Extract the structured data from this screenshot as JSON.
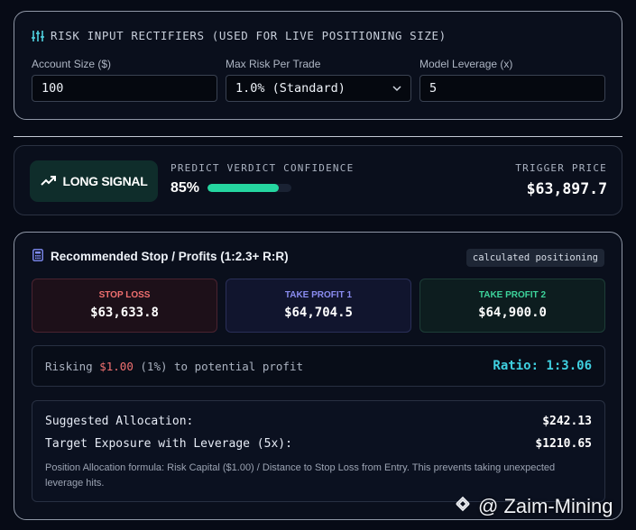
{
  "inputs": {
    "header": "RISK INPUT RECTIFIERS (USED FOR LIVE POSITIONING SIZE)",
    "header_icon": "sliders-icon",
    "account_size": {
      "label": "Account Size ($)",
      "value": "100"
    },
    "max_risk": {
      "label": "Max Risk Per Trade",
      "value": "1.0% (Standard)"
    },
    "leverage": {
      "label": "Model Leverage (x)",
      "value": "5"
    }
  },
  "signal": {
    "badge_label": "LONG SIGNAL",
    "badge_icon": "trending-up-icon",
    "confidence_label": "PREDICT VERDICT CONFIDENCE",
    "confidence_value": "85%",
    "confidence_fraction": 0.85,
    "trigger_label": "TRIGGER PRICE",
    "trigger_value": "$63,897.7"
  },
  "stops": {
    "title": "Recommended Stop / Profits (1:2.3+ R:R)",
    "title_icon": "calculator-icon",
    "badge": "calculated positioning",
    "levels": [
      {
        "label": "STOP LOSS",
        "value": "$63,633.8"
      },
      {
        "label": "TAKE PROFIT 1",
        "value": "$64,704.5"
      },
      {
        "label": "TAKE PROFIT 2",
        "value": "$64,900.0"
      }
    ],
    "risk": {
      "prefix": "Risking",
      "amount": "$1.00",
      "suffix": "(1%) to potential profit",
      "ratio": "Ratio: 1:3.06"
    },
    "allocation": {
      "suggested_label": "Suggested Allocation:",
      "suggested_value": "$242.13",
      "exposure_label": "Target Exposure with Leverage (5x):",
      "exposure_value": "$1210.65",
      "note": "Position Allocation formula: Risk Capital ($1.00) / Distance to Stop Loss from Entry. This prevents taking unexpected leverage hits."
    }
  },
  "watermark": {
    "text": "@ Zaim-Mining",
    "icon": "binance-logo-icon"
  },
  "colors": {
    "accent_green": "#25d6a0",
    "stop_loss": "#ef6f6f",
    "take_profit_1": "#8a8cf0",
    "take_profit_2": "#3dd39b",
    "ratio": "#3fd0e0"
  }
}
